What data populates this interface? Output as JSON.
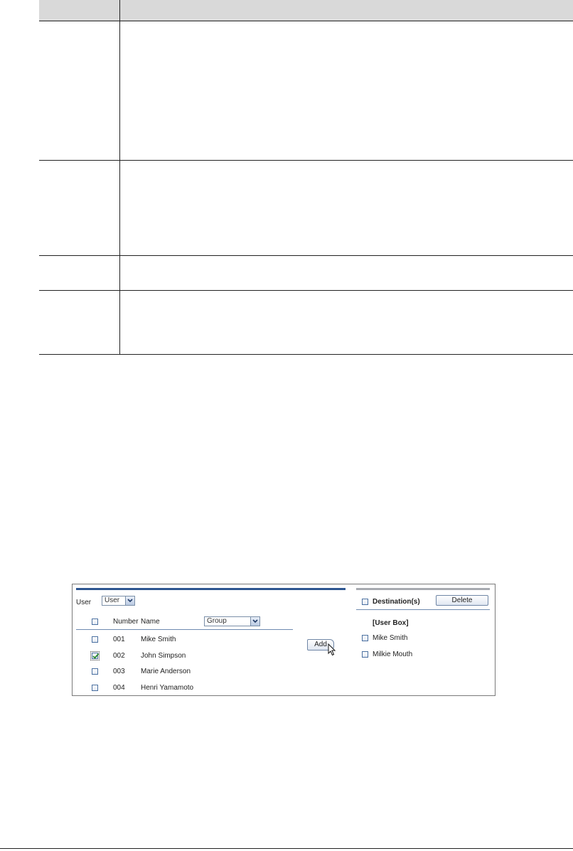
{
  "panel": {
    "user_label": "User",
    "user_select_value": "User",
    "destinations_label": "Destination(s)",
    "delete_button": "Delete",
    "columns": {
      "number": "Number",
      "name": "Name"
    },
    "group_select_value": "Group",
    "add_button": "Add",
    "users": [
      {
        "number": "001",
        "name": "Mike Smith",
        "checked": false
      },
      {
        "number": "002",
        "name": "John Simpson",
        "checked": true
      },
      {
        "number": "003",
        "name": "Marie Anderson",
        "checked": false
      },
      {
        "number": "004",
        "name": "Henri Yamamoto",
        "checked": false
      }
    ],
    "destination_group": "[User Box]",
    "destinations": [
      {
        "name": "Mike Smith",
        "checked": false
      },
      {
        "name": "Milkie Mouth",
        "checked": false
      }
    ]
  },
  "icons": {
    "dropdown": "chevron-down-icon",
    "check": "check-icon",
    "cursor": "mouse-pointer-icon"
  }
}
